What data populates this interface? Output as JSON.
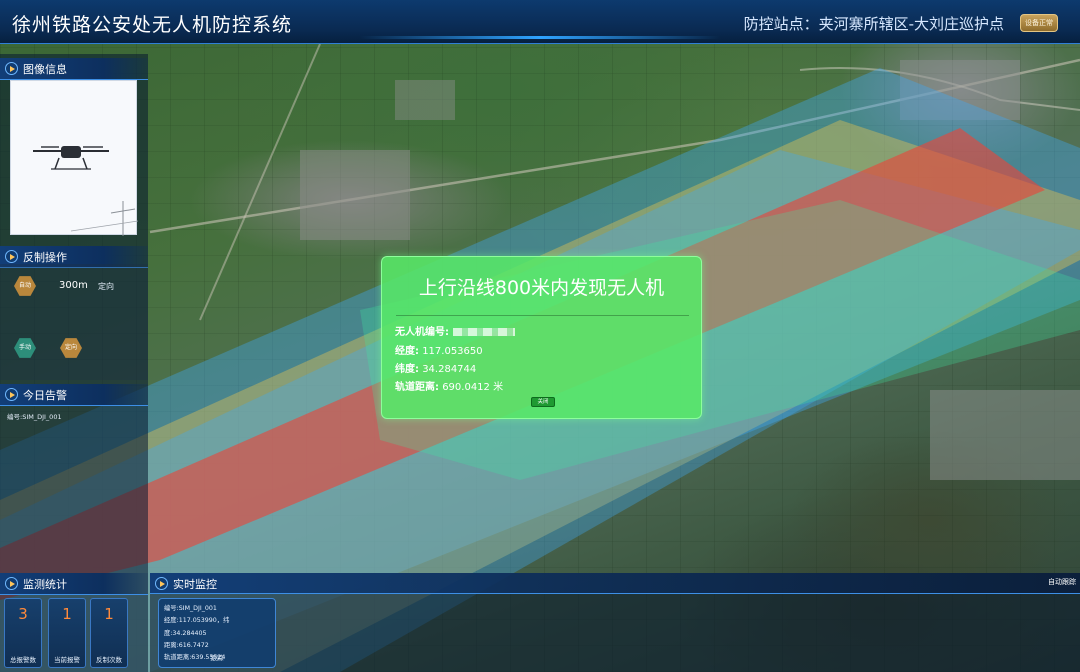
{
  "header": {
    "title": "徐州铁路公安处无人机防控系统",
    "station_label": "防控站点：",
    "station_name": "夹河寨所辖区-大刘庄巡护点",
    "status_badge": "设备正常"
  },
  "left_panel": {
    "image_info": {
      "title": "图像信息"
    },
    "counter_ops": {
      "title": "反制操作",
      "auto_label": "自动",
      "range": "300m",
      "mode": "定向",
      "manual_label": "手动",
      "direct_label": "定向"
    },
    "today_alarms": {
      "title": "今日告警",
      "items": [
        {
          "text": "编号:SIM_DJI_001"
        }
      ]
    },
    "monitor_stats": {
      "title": "监测统计",
      "items": [
        {
          "value": "3",
          "label": "总报警数"
        },
        {
          "value": "1",
          "label": "当前报警"
        },
        {
          "value": "1",
          "label": "反制次数"
        }
      ]
    }
  },
  "realtime": {
    "title": "实时监控",
    "auto_track": "自动跟踪",
    "card": {
      "id": "编号:SIM_DJI_001",
      "coords": "经度:117.053990，纬度:34.284405",
      "distance": "距离:616.7472",
      "track_distance": "轨道距离:639.55524",
      "track_button": "跟踪"
    }
  },
  "alert": {
    "title": "上行沿线800米内发现无人机",
    "drone_id_label": "无人机编号:",
    "lon_label": "经度:",
    "lon_value": "117.053650",
    "lat_label": "纬度:",
    "lat_value": "34.284744",
    "dist_label": "轨道距离:",
    "dist_value": "690.0412 米",
    "close_button": "关闭"
  },
  "colors": {
    "zone_red": "#e8463a",
    "zone_blue": "#3ea8f5",
    "zone_yellow": "#f2c84b",
    "alert_green": "#58e868",
    "header_blue": "#0d3a6e",
    "stat_orange": "#ff8a3a"
  }
}
